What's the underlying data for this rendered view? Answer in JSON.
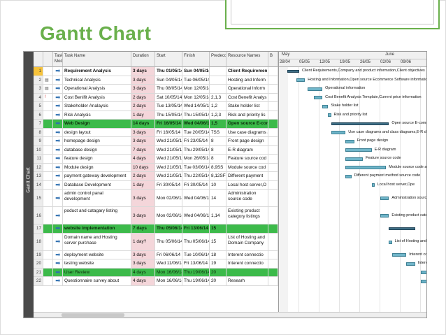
{
  "slide": {
    "title": "Gantt Chart"
  },
  "view_bar": {
    "label": "Gantt Chart"
  },
  "columns": {
    "task_mode": "Task Mode",
    "task_name": "Task Name",
    "duration": "Duration",
    "start": "Start",
    "finish": "Finish",
    "predecessors": "Predeco",
    "resource_names": "Resource Names",
    "add": "B"
  },
  "timescale": {
    "months": [
      "May",
      "June"
    ],
    "weeks": [
      "28/04",
      "05/05",
      "12/05",
      "19/05",
      "26/05",
      "02/06",
      "09/06"
    ]
  },
  "tasks": [
    {
      "id": "1",
      "name": "Requirement Analysis",
      "duration": "3 days",
      "start": "Thu 01/05/14",
      "finish": "Sun 04/05/14",
      "pred": "",
      "res": "Client Requiremen",
      "summary": true,
      "green": false,
      "indicator": ""
    },
    {
      "id": "2",
      "name": "Technical Analysis",
      "duration": "3 days",
      "start": "Sun 04/05/14",
      "finish": "Tue 06/05/14",
      "pred": "",
      "res": "Hosting and Inform",
      "summary": false,
      "green": false,
      "indicator": "▤"
    },
    {
      "id": "3",
      "name": "Operational Analysis",
      "duration": "3 days",
      "start": "Thu 08/05/14",
      "finish": "Mon 12/05/14",
      "pred": "",
      "res": "Operational Inform",
      "summary": false,
      "green": false,
      "indicator": "▤"
    },
    {
      "id": "4",
      "name": "Cost Benifit Analysis",
      "duration": "2 days",
      "start": "Sat 10/05/14",
      "finish": "Mon 12/05/14",
      "pred": "2,1,3",
      "res": "Cost Benefit Analys",
      "summary": false,
      "green": false,
      "indicator": "!"
    },
    {
      "id": "5",
      "name": "Stakeholder Analaysis",
      "duration": "2 days",
      "start": "Tue 13/05/14",
      "finish": "Wed 14/05/14",
      "pred": "1,2",
      "res": "Stake holder list",
      "summary": false,
      "green": false,
      "indicator": ""
    },
    {
      "id": "6",
      "name": "Risk Analysis",
      "duration": "1 day",
      "start": "Thu 15/05/14",
      "finish": "Thu 15/05/14",
      "pred": "1,2,3",
      "res": "Risk and priority lis",
      "summary": false,
      "green": false,
      "indicator": ""
    },
    {
      "id": "7",
      "name": "Web Design",
      "duration": "14 days",
      "start": "Fri 16/05/14",
      "finish": "Wed 04/06/14",
      "pred": "1,5",
      "res": "Open source E-com",
      "summary": true,
      "green": true,
      "indicator": ""
    },
    {
      "id": "8",
      "name": "design layout",
      "duration": "3 days",
      "start": "Fri 16/05/14",
      "finish": "Tue 20/05/14",
      "pred": "7SS",
      "res": "Use case diagrams a",
      "summary": false,
      "green": false,
      "indicator": ""
    },
    {
      "id": "9",
      "name": "homepage design",
      "duration": "3 days",
      "start": "Wed 21/05/14",
      "finish": "Fri 23/05/14",
      "pred": "8",
      "res": "Front page design",
      "summary": false,
      "green": false,
      "indicator": ""
    },
    {
      "id": "10",
      "name": "database design",
      "duration": "7 days",
      "start": "Wed 21/05/14",
      "finish": "Thu 29/05/14",
      "pred": "8",
      "res": "E-R diagram",
      "summary": false,
      "green": false,
      "indicator": ""
    },
    {
      "id": "11",
      "name": "feature design",
      "duration": "4 days",
      "start": "Wed 21/05/14",
      "finish": "Mon 26/05/14",
      "pred": "8",
      "res": "Feature source cod",
      "summary": false,
      "green": false,
      "indicator": ""
    },
    {
      "id": "12",
      "name": "Module design",
      "duration": "10 days",
      "start": "Wed 21/05/14",
      "finish": "Tue 03/06/14",
      "pred": "8,9SS",
      "res": "Module source cod",
      "summary": false,
      "green": false,
      "indicator": ""
    },
    {
      "id": "13",
      "name": "payment gateway development",
      "duration": "2 days",
      "start": "Wed 21/05/14",
      "finish": "Thu 22/05/14",
      "pred": "8,12SF",
      "res": "Different payment",
      "summary": false,
      "green": false,
      "indicator": ""
    },
    {
      "id": "14",
      "name": "Database Development",
      "duration": "1 day",
      "start": "Fri 30/05/14",
      "finish": "Fri 30/05/14",
      "pred": "10",
      "res": "Local host server,O",
      "summary": false,
      "green": false,
      "indicator": ""
    },
    {
      "id": "15",
      "name": "admin control panal development",
      "duration": "3 days",
      "start": "Mon 02/06/14",
      "finish": "Wed 04/06/14",
      "pred": "14",
      "res": "Administration source code",
      "summary": false,
      "green": false,
      "indicator": ""
    },
    {
      "id": "16",
      "name": "poduct and catagary listing",
      "duration": "3 days",
      "start": "Mon 02/06/14",
      "finish": "Wed 04/06/14",
      "pred": "1,14",
      "res": "Existing product category listings",
      "summary": false,
      "green": false,
      "indicator": ""
    },
    {
      "id": "17",
      "name": "website implementation",
      "duration": "7 days",
      "start": "Thu 05/06/14",
      "finish": "Fri 13/06/14",
      "pred": "15",
      "res": "",
      "summary": true,
      "green": true,
      "indicator": ""
    },
    {
      "id": "18",
      "name": "Domain name and Hosting server purchase",
      "duration": "1 day?",
      "start": "Thu 05/06/14",
      "finish": "Thu 05/06/14",
      "pred": "15",
      "res": "List of Hosting and Domain Company",
      "summary": false,
      "green": false,
      "indicator": ""
    },
    {
      "id": "19",
      "name": "deployment website",
      "duration": "3 days",
      "start": "Fri 06/06/14",
      "finish": "Tue 10/06/14",
      "pred": "18",
      "res": "Interent connectio",
      "summary": false,
      "green": false,
      "indicator": ""
    },
    {
      "id": "20",
      "name": "testing website",
      "duration": "3 days",
      "start": "Wed 11/06/14",
      "finish": "Fri 13/06/14",
      "pred": "19",
      "res": "Interent connectio",
      "summary": false,
      "green": false,
      "indicator": ""
    },
    {
      "id": "21",
      "name": "User Review",
      "duration": "4 days",
      "start": "Mon 16/06/14",
      "finish": "Thu 19/06/14",
      "pred": "20",
      "res": "",
      "summary": false,
      "green": true,
      "indicator": ""
    },
    {
      "id": "22",
      "name": "Questionnaire survey about",
      "duration": "4 days",
      "start": "Mon 16/06/14",
      "finish": "Thu 19/06/14",
      "pred": "20",
      "res": "Researh",
      "summary": false,
      "green": false,
      "indicator": ""
    }
  ],
  "gantt_labels": [
    {
      "row": 1,
      "text": "Client Requirements,Company and product information,Client objectives"
    },
    {
      "row": 2,
      "text": "Hosting and Information,Open source Ecommerce Software information,Int"
    },
    {
      "row": 3,
      "text": "Operational information"
    },
    {
      "row": 4,
      "text": "Cost Benefit Analysis Template,Current price information"
    },
    {
      "row": 5,
      "text": "Stake holder list"
    },
    {
      "row": 6,
      "text": "Risk and priority list"
    },
    {
      "row": 7,
      "text": "Open source E-comme"
    },
    {
      "row": 8,
      "text": "Use case diagrams and class diagrams,E-R diagram"
    },
    {
      "row": 9,
      "text": "Front page design"
    },
    {
      "row": 10,
      "text": "E-R diagram"
    },
    {
      "row": 11,
      "text": "Feature source code"
    },
    {
      "row": 12,
      "text": "Module source code and"
    },
    {
      "row": 13,
      "text": "Different payment method source code"
    },
    {
      "row": 14,
      "text": "Local host server,Ope"
    },
    {
      "row": 15,
      "text": "Administration source"
    },
    {
      "row": 16,
      "text": "Existing product categ"
    },
    {
      "row": 18,
      "text": "List of Hosting and Do"
    },
    {
      "row": 19,
      "text": "Interent co"
    },
    {
      "row": 20,
      "text": "Interen"
    }
  ],
  "colors": {
    "title_green": "#6ab04c",
    "summary_row": "#3cba4a",
    "bar": "#6fb5c9",
    "duration_highlight": "#f4d6da",
    "selected_row": "#f7c33a"
  }
}
